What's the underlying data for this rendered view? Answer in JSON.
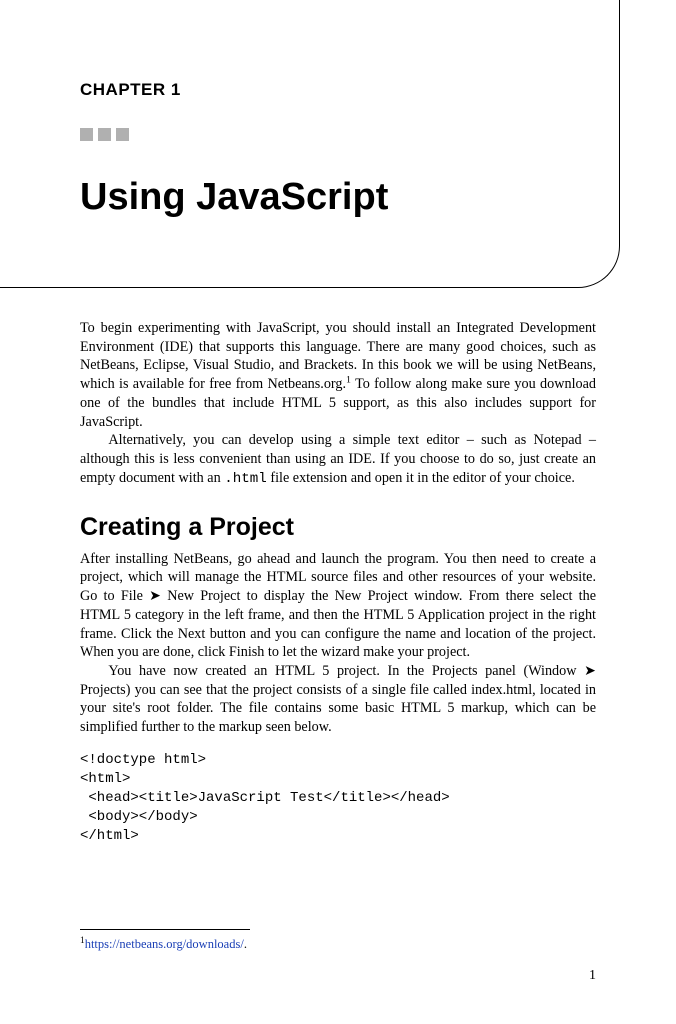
{
  "chapter": {
    "label": "CHAPTER 1",
    "title": "Using JavaScript"
  },
  "paragraphs": {
    "p1": "To begin experimenting with JavaScript, you should install an Integrated Development Environment (IDE) that supports this language. There are many good choices, such as NetBeans, Eclipse, Visual Studio, and Brackets. In this book we will be using NetBeans, which is available for free from Netbeans.org.",
    "p1b": " To follow along make sure you download one of the bundles that include HTML 5 support, as this also includes support for JavaScript.",
    "p2a": "Alternatively, you can develop using a simple text editor – such as Notepad – although this is less convenient than using an IDE. If you choose to do so, just create an empty document with an ",
    "p2code": ".html",
    "p2b": " file extension and open it in the editor of your choice."
  },
  "section": {
    "heading": "Creating a Project",
    "p1a": "After installing NetBeans, go ahead and launch the program. You then need to create a project, which will manage the HTML source files and other resources of your website. Go to File ",
    "arrow1": "➤",
    "p1b": " New Project to display the New Project window. From there select the HTML 5 category in the left frame, and then the HTML 5 Application project in the right frame. Click the Next button and you can configure the name and location of the project. When you are done, click Finish to let the wizard make your project.",
    "p2a": "You have now created an HTML 5 project. In the Projects panel (Window ",
    "arrow2": "➤",
    "p2b": " Projects) you can see that the project consists of a single file called index.html, located in your site's root folder. The file contains some basic HTML 5 markup, which can be simplified further to the markup seen below."
  },
  "code": "<!doctype html>\n<html>\n <head><title>JavaScript Test</title></head>\n <body></body>\n</html>",
  "footnote": {
    "num": "1",
    "link_text": "https://netbeans.org/downloads/",
    "period": "."
  },
  "page_number": "1"
}
